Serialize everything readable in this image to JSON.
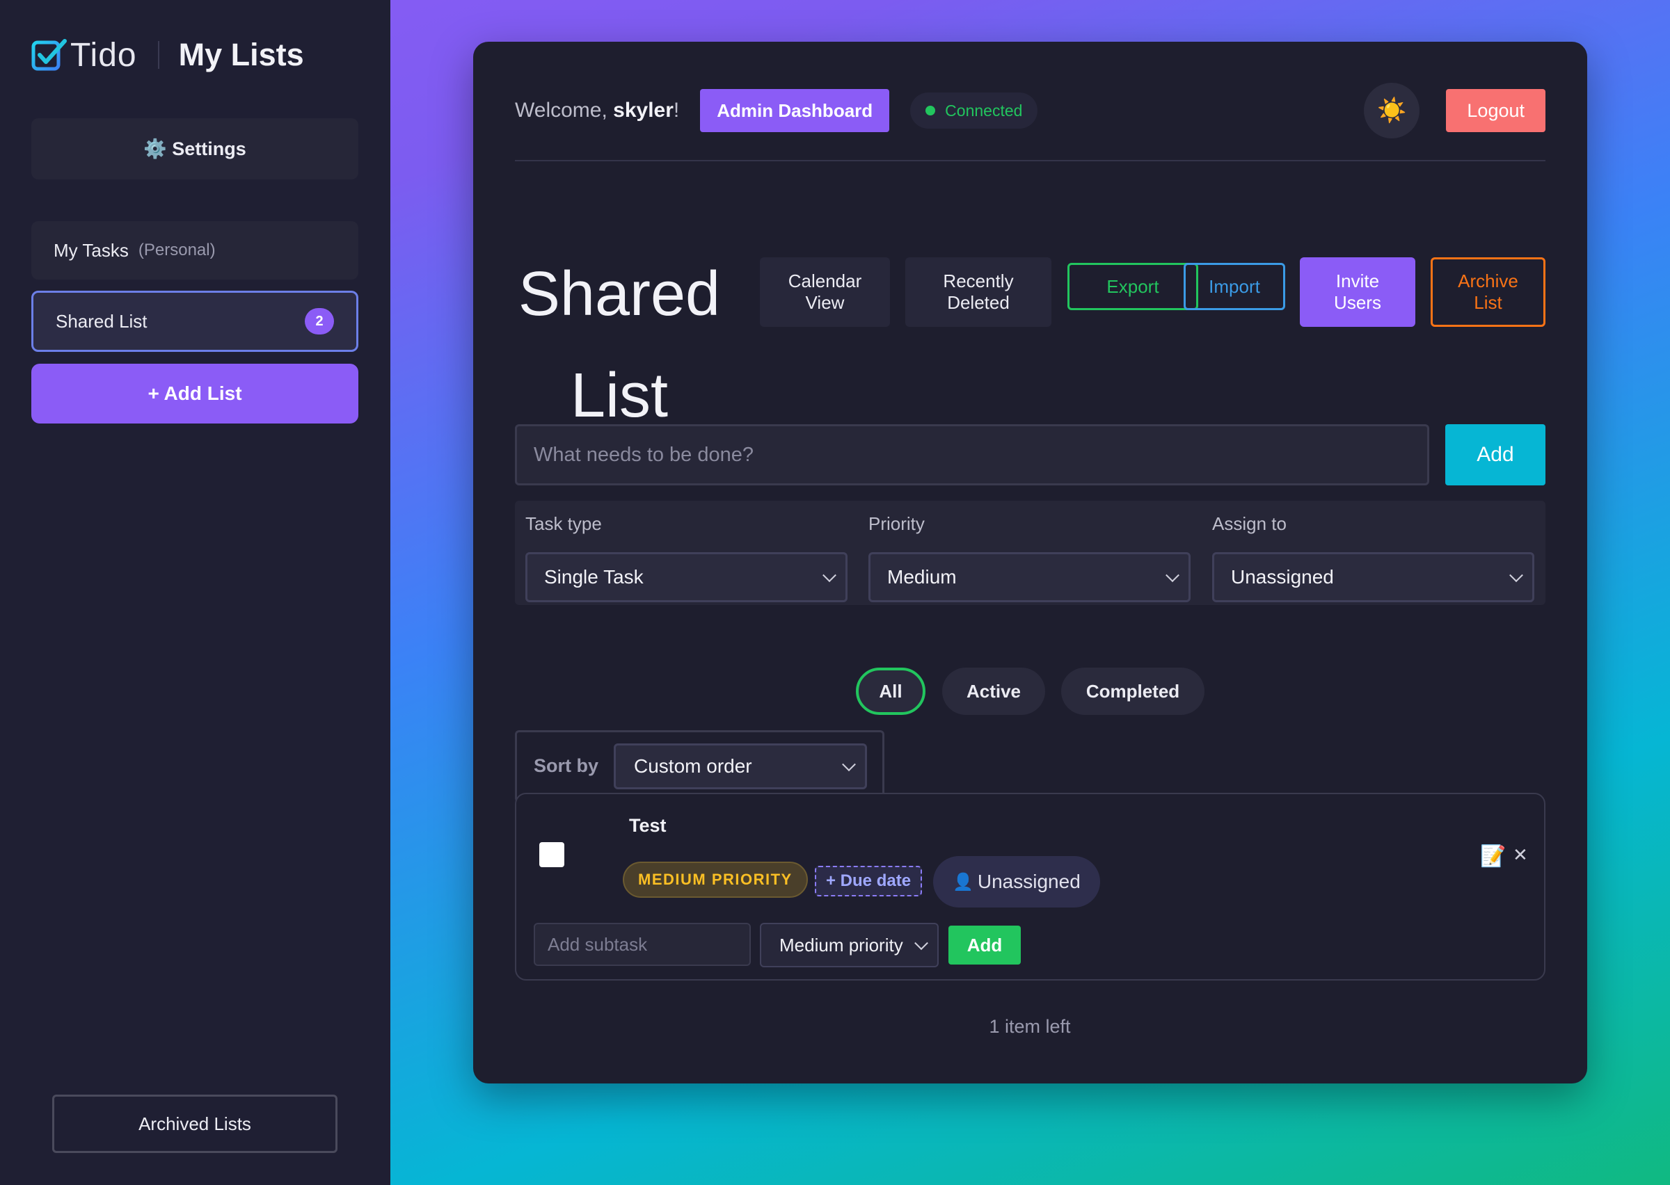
{
  "sidebar": {
    "brand_name": "Tido",
    "title": "My Lists",
    "settings_label": "⚙️ Settings",
    "lists": [
      {
        "label": "My Tasks",
        "sub": "(Personal)"
      },
      {
        "label": "Shared List",
        "count": "2"
      }
    ],
    "add_list_label": "+ Add List",
    "archived_label": "Archived Lists"
  },
  "header": {
    "welcome_prefix": "Welcome, ",
    "username": "skyler",
    "welcome_suffix": "!",
    "admin_label": "Admin Dashboard",
    "connection_status": "Connected",
    "theme_icon": "☀️",
    "logout_label": "Logout"
  },
  "list": {
    "title_line1": "Shared",
    "title_line2": "List",
    "actions": {
      "calendar": "Calendar View",
      "recently_deleted": "Recently Deleted",
      "export": "Export",
      "import": "Import",
      "invite": "Invite Users",
      "archive": "Archive List"
    }
  },
  "new_task": {
    "placeholder": "What needs to be done?",
    "add_label": "Add",
    "task_type_label": "Task type",
    "task_type_value": "Single Task",
    "priority_label": "Priority",
    "priority_value": "Medium",
    "assign_label": "Assign to",
    "assign_value": "Unassigned"
  },
  "filters": {
    "all": "All",
    "active": "Active",
    "completed": "Completed",
    "selected": "All"
  },
  "sort": {
    "label": "Sort by",
    "value": "Custom order"
  },
  "tasks": [
    {
      "title": "Test",
      "priority_badge": "MEDIUM PRIORITY",
      "due_badge": "+ Due date",
      "assignee_icon": "👤",
      "assignee": "Unassigned",
      "edit_icon": "📝",
      "delete_icon": "✕",
      "subtask_placeholder": "Add subtask",
      "subtask_priority": "Medium priority",
      "subtask_add": "Add"
    }
  ],
  "footer": {
    "items_left": "1 item left"
  },
  "colors": {
    "accent": "#8b5cf6",
    "success": "#22c55e",
    "info": "#06b6d4",
    "danger": "#f87171",
    "warning": "#f97316"
  }
}
